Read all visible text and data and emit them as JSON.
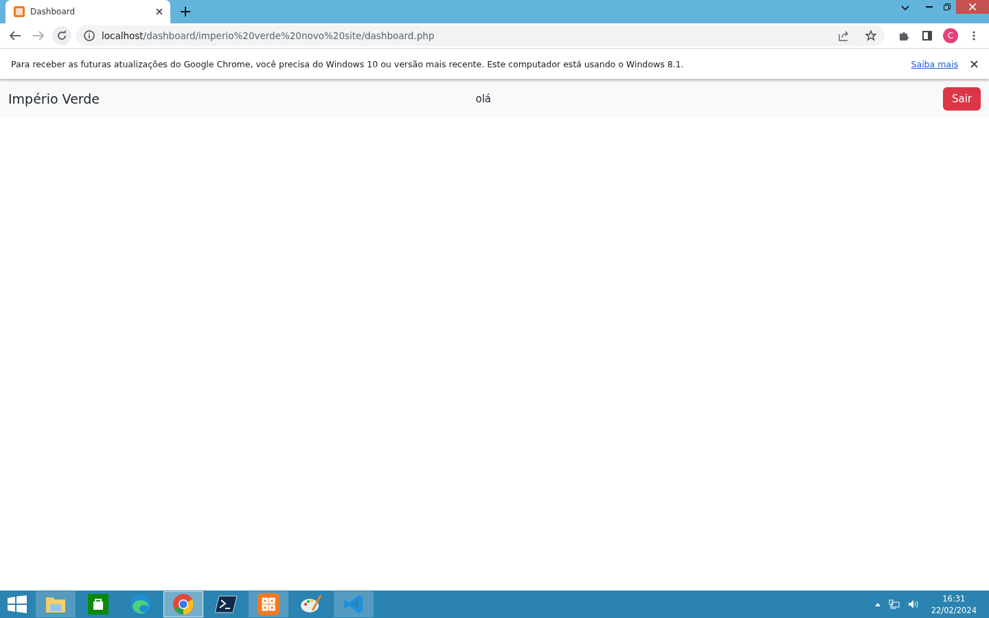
{
  "browser": {
    "tabs": [
      {
        "title": "Dashboard",
        "selected": true
      }
    ],
    "url_host": "localhost",
    "url_path": "/dashboard/imperio%20verde%20novo%20site/dashboard.php",
    "profile_initial": "C"
  },
  "infobar": {
    "message": "Para receber as futuras atualizações do Google Chrome, você precisa do Windows 10 ou versão mais recente. Este computador está usando o Windows 8.1.",
    "link": "Saiba mais"
  },
  "navbar": {
    "brand": "Império Verde",
    "greeting": "olá",
    "logout_button": "Sair"
  },
  "taskbar": {
    "apps": [
      {
        "kind": "explorer",
        "running": true,
        "selected": false
      },
      {
        "kind": "store",
        "running": false,
        "selected": false
      },
      {
        "kind": "edge",
        "running": false,
        "selected": false
      },
      {
        "kind": "chrome",
        "running": true,
        "selected": true
      },
      {
        "kind": "terminal",
        "running": false,
        "selected": false
      },
      {
        "kind": "xampp",
        "running": true,
        "selected": false
      },
      {
        "kind": "paint",
        "running": false,
        "selected": false
      },
      {
        "kind": "vscode",
        "running": true,
        "selected": false
      }
    ],
    "time": "16:31",
    "date": "22/02/2024"
  }
}
